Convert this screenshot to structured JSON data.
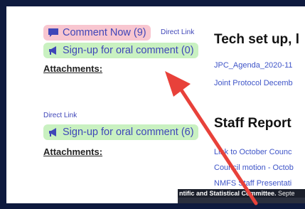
{
  "left_col": {
    "item1": {
      "comment_now": "Comment Now (9)",
      "direct_link": "Direct Link",
      "signup": "Sign-up for oral comment (0)",
      "attachments": "Attachments:"
    },
    "item2": {
      "direct_link": "Direct Link",
      "signup": "Sign-up for oral comment (6)",
      "attachments": "Attachments:"
    }
  },
  "right_col": {
    "heading1": "Tech set up, l",
    "links1": [
      "JPC_Agenda_2020-11",
      "Joint Protocol Decemb"
    ],
    "heading2": "Staff Report",
    "links2": [
      "Link to October Counc",
      "Council motion - Octob",
      "NMFS Staff Presentati"
    ]
  },
  "footer": {
    "bold": "ntific and Statistical Committee.",
    "rest": " Septe"
  },
  "colors": {
    "frame": "#0e1a3e",
    "pink_pill": "#f8c6d0",
    "green_pill": "#c9f1c1",
    "link": "#3f46b8",
    "arrow": "#e8413a"
  },
  "icons": {
    "comment": "speech-bubble-icon",
    "signup": "megaphone-icon",
    "annotation": "red-arrow-annotation"
  }
}
